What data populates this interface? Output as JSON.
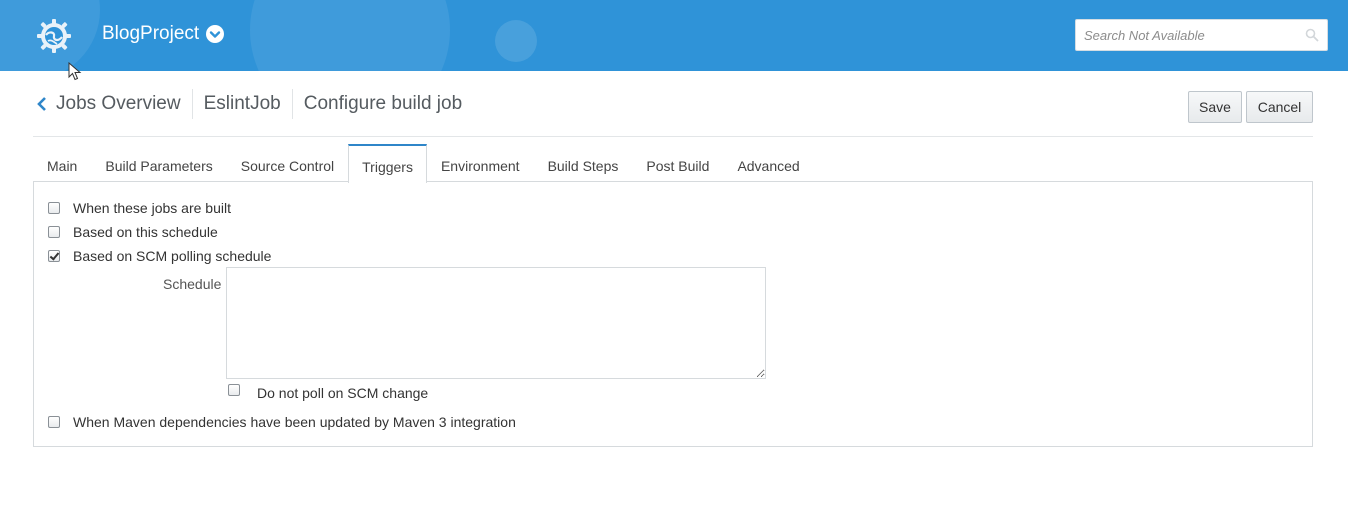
{
  "header": {
    "project_name": "BlogProject",
    "search_placeholder": "Search Not Available",
    "logo_icon": "gear-globe-icon",
    "bar_color": "#2f93d8"
  },
  "breadcrumb": {
    "items": [
      "Jobs Overview",
      "EslintJob",
      "Configure build job"
    ]
  },
  "actions": {
    "save_label": "Save",
    "cancel_label": "Cancel"
  },
  "tabs": {
    "items": [
      "Main",
      "Build Parameters",
      "Source Control",
      "Triggers",
      "Environment",
      "Build Steps",
      "Post Build",
      "Advanced"
    ],
    "active": "Triggers"
  },
  "triggers": {
    "options": [
      {
        "label": "When these jobs are built",
        "checked": false
      },
      {
        "label": "Based on this schedule",
        "checked": false
      },
      {
        "label": "Based on SCM polling schedule",
        "checked": true
      },
      {
        "label": "When Maven dependencies have been updated by Maven 3 integration",
        "checked": false
      }
    ],
    "schedule_label": "Schedule",
    "schedule_value": "",
    "no_poll_label": "Do not poll on SCM change",
    "no_poll_checked": false
  }
}
